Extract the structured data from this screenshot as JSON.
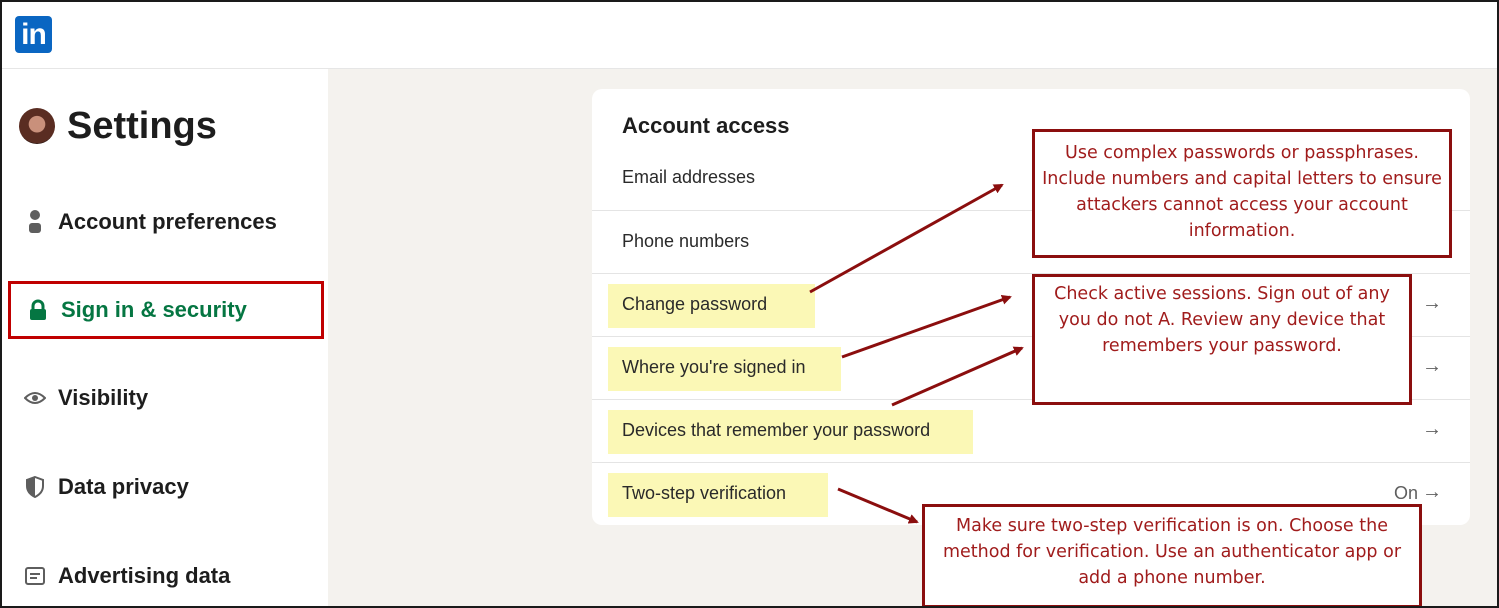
{
  "header": {
    "logo_text": "in"
  },
  "sidebar": {
    "title": "Settings",
    "items": [
      {
        "label": "Account preferences",
        "icon": "person-icon"
      },
      {
        "label": "Sign in & security",
        "icon": "lock-icon",
        "active": true
      },
      {
        "label": "Visibility",
        "icon": "eye-icon"
      },
      {
        "label": "Data privacy",
        "icon": "shield-icon"
      },
      {
        "label": "Advertising data",
        "icon": "ad-icon"
      }
    ]
  },
  "main": {
    "section_title": "Account access",
    "rows": [
      {
        "label": "Email addresses"
      },
      {
        "label": "Phone numbers"
      },
      {
        "label": "Change password",
        "arrow": "→"
      },
      {
        "label": "Where you're signed in",
        "arrow": "→"
      },
      {
        "label": "Devices that remember your password",
        "arrow": "→"
      },
      {
        "label": "Two-step verification",
        "state": "On",
        "arrow": "→"
      }
    ]
  },
  "callouts": {
    "password": "Use complex passwords or passphrases. Include numbers and capital letters to ensure attackers cannot access your account information.",
    "sessions": "Check active sessions.  Sign out of any you do  not A. Review any device that remembers your password.",
    "two_step": "Make sure two-step verification is on. Choose the method for verification. Use an authenticator app or add a phone number."
  },
  "colors": {
    "accent_green": "#057642",
    "brand_blue": "#0a66c2",
    "annotation_red": "#8b0e0e",
    "highlight_yellow": "#fbf8b6"
  }
}
